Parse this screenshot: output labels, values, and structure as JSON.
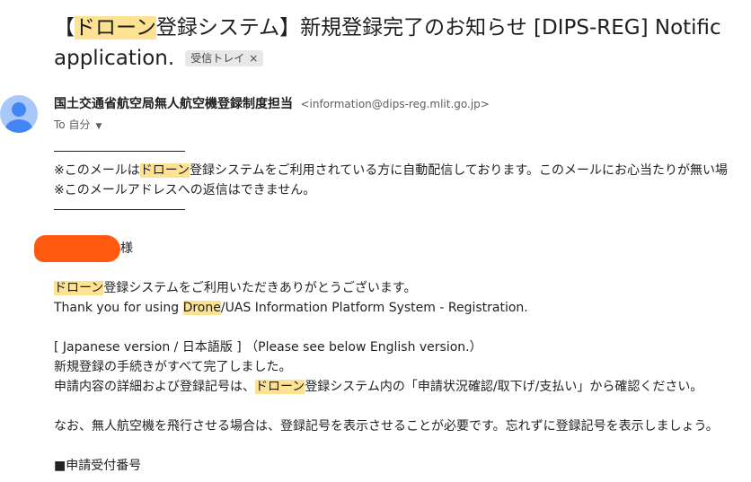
{
  "subject": {
    "prefix": "【",
    "highlight": "ドローン",
    "rest": "登録システム】新規登録完了のお知らせ [DIPS-REG] Notific",
    "line2": "application.",
    "label": "受信トレイ",
    "label_close": "×"
  },
  "sender": {
    "name": "国土交通省航空局無人航空機登録制度担当",
    "email": "<information@dips-reg.mlit.go.jp>",
    "to": "To 自分",
    "to_caret": "▼"
  },
  "body": {
    "notice1_a": "※このメールは",
    "notice1_hl": "ドローン",
    "notice1_b": "登録システムをご利用されている方に自動配信しております。このメールにお心当たりが無い場",
    "notice2": "※このメールアドレスへの返信はできません。",
    "greeting_suffix": "様",
    "thanks_hl": "ドローン",
    "thanks_ja": "登録システムをご利用いただきありがとうございます。",
    "thanks_en_a": "Thank you for using ",
    "thanks_en_hl": "Drone",
    "thanks_en_b": "/UAS Information Platform System - Registration.",
    "version_line": "[ Japanese version / 日本語版 ] （Please see below English version.）",
    "complete_line": "新規登録の手続きがすべて完了しました。",
    "details_a": "申請内容の詳細および登録記号は、",
    "details_hl": "ドローン",
    "details_b": "登録システム内の「申請状況確認/取下げ/支払い」から確認ください。",
    "flight_line": "なお、無人航空機を飛行させる場合は、登録記号を表示させることが必要です。忘れずに登録記号を表示しましょう。",
    "receipt_heading": "■申請受付番号"
  },
  "colors": {
    "highlight": "#fde293",
    "redaction": "#ff5a10",
    "avatar_bg": "#a8c7fa",
    "avatar_fg": "#4285f4"
  }
}
